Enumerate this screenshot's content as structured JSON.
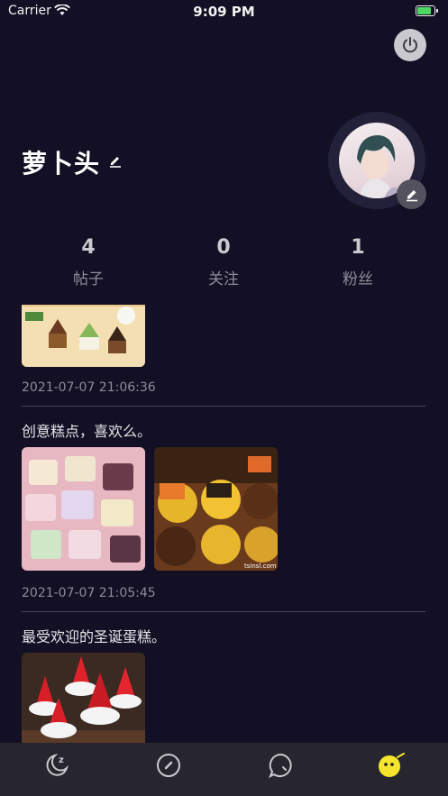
{
  "status_bar": {
    "carrier": "Carrier",
    "time": "9:09 PM"
  },
  "profile": {
    "username": "萝卜头",
    "stats": [
      {
        "count": "4",
        "label": "帖子"
      },
      {
        "count": "0",
        "label": "关注"
      },
      {
        "count": "1",
        "label": "粉丝"
      }
    ]
  },
  "posts": [
    {
      "timestamp": "2021-07-07 21:06:36"
    },
    {
      "text": "创意糕点，喜欢么。",
      "timestamp": "2021-07-07 21:05:45"
    },
    {
      "text": "最受欢迎的圣诞蛋糕。"
    }
  ],
  "watermark": "tsinsl.com",
  "tabs": [
    {
      "icon": "sleep-moon-icon"
    },
    {
      "icon": "compass-icon"
    },
    {
      "icon": "chat-bubble-icon"
    },
    {
      "icon": "emoji-face-icon",
      "active": true
    }
  ],
  "colors": {
    "background": "#130f24",
    "tab_active": "#f5e52d",
    "tab_inactive": "#c9c9cf"
  }
}
